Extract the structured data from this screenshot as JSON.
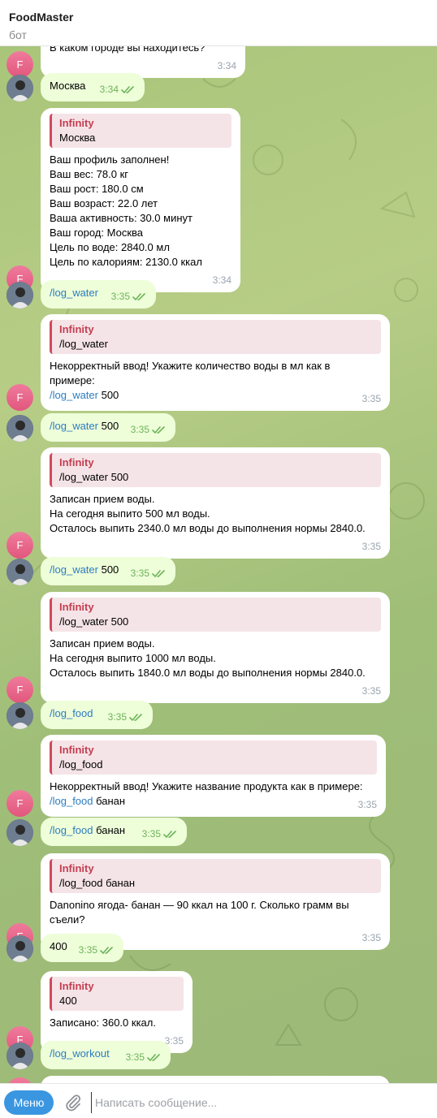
{
  "header": {
    "title": "FoodMaster",
    "subtitle": "бот"
  },
  "colors": {
    "accent": "#3a96e0",
    "quote_name": "#c43d50",
    "outgoing_bubble": "#eefed9",
    "check": "#6db35a",
    "bot_avatar": "#e2567d"
  },
  "bot_avatar_letter": "F",
  "quote_name": "Infinity",
  "messages": [
    {
      "type": "in",
      "lines": [
        "В каком городе вы находитесь?"
      ],
      "time": "3:34"
    },
    {
      "type": "out",
      "text": "Москва",
      "time": "3:34"
    },
    {
      "type": "in",
      "quote": "Москва",
      "lines": [
        "Ваш профиль заполнен!",
        "Ваш вес: 78.0 кг",
        "Ваш рост: 180.0 см",
        "Ваш возраст: 22.0 лет",
        "Ваша активность: 30.0 минут",
        "Ваш город: Москва",
        "Цель по воде: 2840.0 мл",
        "Цель по калориям: 2130.0 ккал"
      ],
      "time": "3:34"
    },
    {
      "type": "out",
      "cmd": "/log_water",
      "text": "",
      "time": "3:35"
    },
    {
      "type": "in",
      "quote": "/log_water",
      "lines": [
        "Некорректный ввод! Укажите количество воды в мл как в",
        "примере:"
      ],
      "cmd_line": {
        "cmd": "/log_water",
        "rest": " 500"
      },
      "time": "3:35"
    },
    {
      "type": "out",
      "cmd": "/log_water",
      "text": " 500",
      "time": "3:35"
    },
    {
      "type": "in",
      "quote": "/log_water 500",
      "lines": [
        "Записан прием воды.",
        "На сегодня выпито 500 мл воды.",
        "Осталось выпить 2340.0 мл воды до выполнения нормы 2840.0."
      ],
      "time": "3:35"
    },
    {
      "type": "out",
      "cmd": "/log_water",
      "text": " 500",
      "time": "3:35"
    },
    {
      "type": "in",
      "quote": "/log_water 500",
      "lines": [
        "Записан прием воды.",
        "На сегодня выпито 1000 мл воды.",
        "Осталось выпить 1840.0 мл воды до выполнения нормы 2840.0."
      ],
      "time": "3:35"
    },
    {
      "type": "out",
      "cmd": "/log_food",
      "text": "",
      "time": "3:35"
    },
    {
      "type": "in",
      "quote": "/log_food",
      "lines": [
        "Некорректный ввод! Укажите название продукта как в примере:"
      ],
      "cmd_line": {
        "cmd": "/log_food",
        "rest": " банан"
      },
      "time": "3:35"
    },
    {
      "type": "out",
      "cmd": "/log_food",
      "text": " банан",
      "time": "3:35"
    },
    {
      "type": "in",
      "quote": "/log_food банан",
      "lines": [
        "Danonino ягода- банан — 90 ккал на 100 г. Сколько грамм вы",
        "съели?"
      ],
      "time": "3:35"
    },
    {
      "type": "out",
      "cmd": "",
      "text": "400",
      "time": "3:35"
    },
    {
      "type": "in",
      "quote": "400",
      "lines": [
        "Записано: 360.0 ккал."
      ],
      "time": "3:35"
    },
    {
      "type": "out",
      "cmd": "/log_workout",
      "text": "",
      "time": "3:35"
    }
  ],
  "composer": {
    "menu_label": "Меню",
    "placeholder": "Написать сообщение..."
  }
}
